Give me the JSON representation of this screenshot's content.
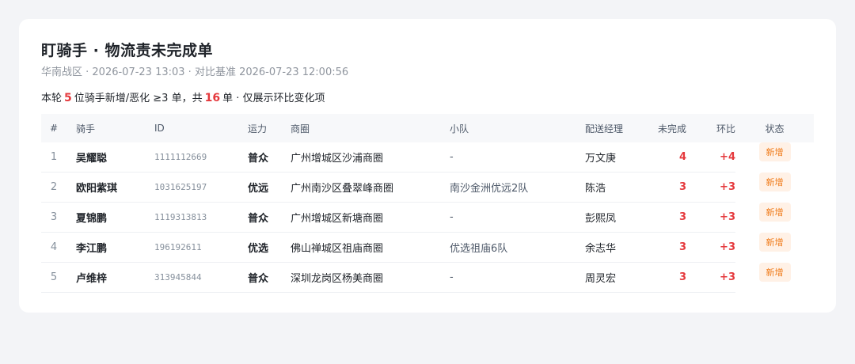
{
  "header": {
    "title": "盯骑手 · 物流责未完成单",
    "subtitle": "华南战区 · 2026-07-23 13:03 · 对比基准 2026-07-23 12:00:56"
  },
  "summary": {
    "prefix": "本轮",
    "rider_count": "5",
    "mid": "位骑手新增/恶化 ≥3 单，共",
    "order_count": "16",
    "suffix": "单 · 仅展示环比变化项"
  },
  "table": {
    "columns": [
      "#",
      "骑手",
      "ID",
      "运力",
      "商圈",
      "小队",
      "配送经理",
      "未完成",
      "环比",
      "状态"
    ],
    "rows": [
      {
        "idx": "1",
        "name": "吴耀聪",
        "id": "1111112669",
        "capacity": "普众",
        "area": "广州增城区沙浦商圈",
        "team": "-",
        "manager": "万文庚",
        "unfinished": "4",
        "change": "+4",
        "status": "新增"
      },
      {
        "idx": "2",
        "name": "欧阳紫琪",
        "id": "1031625197",
        "capacity": "优远",
        "area": "广州南沙区叠翠峰商圈",
        "team": "南沙金洲优远2队",
        "manager": "陈浩",
        "unfinished": "3",
        "change": "+3",
        "status": "新增"
      },
      {
        "idx": "3",
        "name": "夏锦鹏",
        "id": "1119313813",
        "capacity": "普众",
        "area": "广州增城区新塘商圈",
        "team": "-",
        "manager": "彭熙凤",
        "unfinished": "3",
        "change": "+3",
        "status": "新增"
      },
      {
        "idx": "4",
        "name": "李江鹏",
        "id": "196192611",
        "capacity": "优选",
        "area": "佛山禅城区祖庙商圈",
        "team": "优选祖庙6队",
        "manager": "余志华",
        "unfinished": "3",
        "change": "+3",
        "status": "新增"
      },
      {
        "idx": "5",
        "name": "卢维梓",
        "id": "313945844",
        "capacity": "普众",
        "area": "深圳龙岗区杨美商圈",
        "team": "-",
        "manager": "周灵宏",
        "unfinished": "3",
        "change": "+3",
        "status": "新增"
      }
    ]
  },
  "colors": {
    "accent": "#e5393d",
    "badge_bg": "#fff1e6",
    "badge_text": "#f07c1b"
  }
}
